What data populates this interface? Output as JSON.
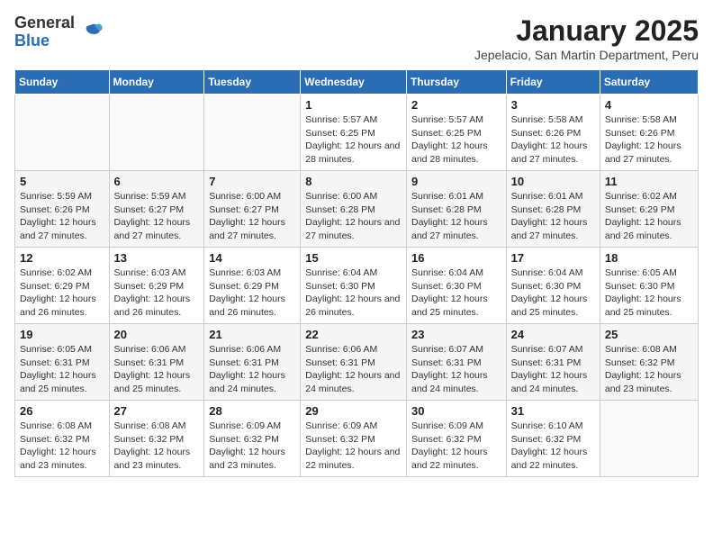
{
  "app": {
    "name_general": "General",
    "name_blue": "Blue"
  },
  "title": "January 2025",
  "subtitle": "Jepelacio, San Martin Department, Peru",
  "days_of_week": [
    "Sunday",
    "Monday",
    "Tuesday",
    "Wednesday",
    "Thursday",
    "Friday",
    "Saturday"
  ],
  "weeks": [
    [
      {
        "day": "",
        "sunrise": "",
        "sunset": "",
        "daylight": ""
      },
      {
        "day": "",
        "sunrise": "",
        "sunset": "",
        "daylight": ""
      },
      {
        "day": "",
        "sunrise": "",
        "sunset": "",
        "daylight": ""
      },
      {
        "day": "1",
        "sunrise": "5:57 AM",
        "sunset": "6:25 PM",
        "daylight": "12 hours and 28 minutes."
      },
      {
        "day": "2",
        "sunrise": "5:57 AM",
        "sunset": "6:25 PM",
        "daylight": "12 hours and 28 minutes."
      },
      {
        "day": "3",
        "sunrise": "5:58 AM",
        "sunset": "6:26 PM",
        "daylight": "12 hours and 27 minutes."
      },
      {
        "day": "4",
        "sunrise": "5:58 AM",
        "sunset": "6:26 PM",
        "daylight": "12 hours and 27 minutes."
      }
    ],
    [
      {
        "day": "5",
        "sunrise": "5:59 AM",
        "sunset": "6:26 PM",
        "daylight": "12 hours and 27 minutes."
      },
      {
        "day": "6",
        "sunrise": "5:59 AM",
        "sunset": "6:27 PM",
        "daylight": "12 hours and 27 minutes."
      },
      {
        "day": "7",
        "sunrise": "6:00 AM",
        "sunset": "6:27 PM",
        "daylight": "12 hours and 27 minutes."
      },
      {
        "day": "8",
        "sunrise": "6:00 AM",
        "sunset": "6:28 PM",
        "daylight": "12 hours and 27 minutes."
      },
      {
        "day": "9",
        "sunrise": "6:01 AM",
        "sunset": "6:28 PM",
        "daylight": "12 hours and 27 minutes."
      },
      {
        "day": "10",
        "sunrise": "6:01 AM",
        "sunset": "6:28 PM",
        "daylight": "12 hours and 27 minutes."
      },
      {
        "day": "11",
        "sunrise": "6:02 AM",
        "sunset": "6:29 PM",
        "daylight": "12 hours and 26 minutes."
      }
    ],
    [
      {
        "day": "12",
        "sunrise": "6:02 AM",
        "sunset": "6:29 PM",
        "daylight": "12 hours and 26 minutes."
      },
      {
        "day": "13",
        "sunrise": "6:03 AM",
        "sunset": "6:29 PM",
        "daylight": "12 hours and 26 minutes."
      },
      {
        "day": "14",
        "sunrise": "6:03 AM",
        "sunset": "6:29 PM",
        "daylight": "12 hours and 26 minutes."
      },
      {
        "day": "15",
        "sunrise": "6:04 AM",
        "sunset": "6:30 PM",
        "daylight": "12 hours and 26 minutes."
      },
      {
        "day": "16",
        "sunrise": "6:04 AM",
        "sunset": "6:30 PM",
        "daylight": "12 hours and 25 minutes."
      },
      {
        "day": "17",
        "sunrise": "6:04 AM",
        "sunset": "6:30 PM",
        "daylight": "12 hours and 25 minutes."
      },
      {
        "day": "18",
        "sunrise": "6:05 AM",
        "sunset": "6:30 PM",
        "daylight": "12 hours and 25 minutes."
      }
    ],
    [
      {
        "day": "19",
        "sunrise": "6:05 AM",
        "sunset": "6:31 PM",
        "daylight": "12 hours and 25 minutes."
      },
      {
        "day": "20",
        "sunrise": "6:06 AM",
        "sunset": "6:31 PM",
        "daylight": "12 hours and 25 minutes."
      },
      {
        "day": "21",
        "sunrise": "6:06 AM",
        "sunset": "6:31 PM",
        "daylight": "12 hours and 24 minutes."
      },
      {
        "day": "22",
        "sunrise": "6:06 AM",
        "sunset": "6:31 PM",
        "daylight": "12 hours and 24 minutes."
      },
      {
        "day": "23",
        "sunrise": "6:07 AM",
        "sunset": "6:31 PM",
        "daylight": "12 hours and 24 minutes."
      },
      {
        "day": "24",
        "sunrise": "6:07 AM",
        "sunset": "6:31 PM",
        "daylight": "12 hours and 24 minutes."
      },
      {
        "day": "25",
        "sunrise": "6:08 AM",
        "sunset": "6:32 PM",
        "daylight": "12 hours and 23 minutes."
      }
    ],
    [
      {
        "day": "26",
        "sunrise": "6:08 AM",
        "sunset": "6:32 PM",
        "daylight": "12 hours and 23 minutes."
      },
      {
        "day": "27",
        "sunrise": "6:08 AM",
        "sunset": "6:32 PM",
        "daylight": "12 hours and 23 minutes."
      },
      {
        "day": "28",
        "sunrise": "6:09 AM",
        "sunset": "6:32 PM",
        "daylight": "12 hours and 23 minutes."
      },
      {
        "day": "29",
        "sunrise": "6:09 AM",
        "sunset": "6:32 PM",
        "daylight": "12 hours and 22 minutes."
      },
      {
        "day": "30",
        "sunrise": "6:09 AM",
        "sunset": "6:32 PM",
        "daylight": "12 hours and 22 minutes."
      },
      {
        "day": "31",
        "sunrise": "6:10 AM",
        "sunset": "6:32 PM",
        "daylight": "12 hours and 22 minutes."
      },
      {
        "day": "",
        "sunrise": "",
        "sunset": "",
        "daylight": ""
      }
    ]
  ]
}
